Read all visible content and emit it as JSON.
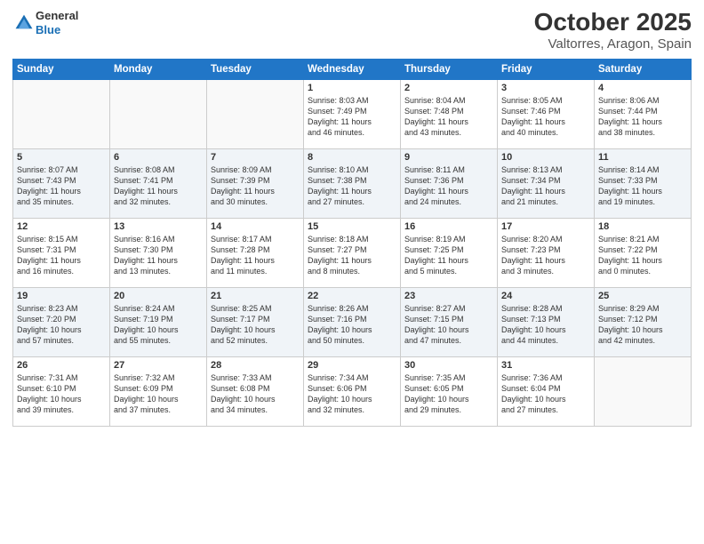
{
  "header": {
    "logo_line1": "General",
    "logo_line2": "Blue",
    "title": "October 2025",
    "subtitle": "Valtorres, Aragon, Spain"
  },
  "days_of_week": [
    "Sunday",
    "Monday",
    "Tuesday",
    "Wednesday",
    "Thursday",
    "Friday",
    "Saturday"
  ],
  "weeks": [
    [
      {
        "num": "",
        "info": ""
      },
      {
        "num": "",
        "info": ""
      },
      {
        "num": "",
        "info": ""
      },
      {
        "num": "1",
        "info": "Sunrise: 8:03 AM\nSunset: 7:49 PM\nDaylight: 11 hours\nand 46 minutes."
      },
      {
        "num": "2",
        "info": "Sunrise: 8:04 AM\nSunset: 7:48 PM\nDaylight: 11 hours\nand 43 minutes."
      },
      {
        "num": "3",
        "info": "Sunrise: 8:05 AM\nSunset: 7:46 PM\nDaylight: 11 hours\nand 40 minutes."
      },
      {
        "num": "4",
        "info": "Sunrise: 8:06 AM\nSunset: 7:44 PM\nDaylight: 11 hours\nand 38 minutes."
      }
    ],
    [
      {
        "num": "5",
        "info": "Sunrise: 8:07 AM\nSunset: 7:43 PM\nDaylight: 11 hours\nand 35 minutes."
      },
      {
        "num": "6",
        "info": "Sunrise: 8:08 AM\nSunset: 7:41 PM\nDaylight: 11 hours\nand 32 minutes."
      },
      {
        "num": "7",
        "info": "Sunrise: 8:09 AM\nSunset: 7:39 PM\nDaylight: 11 hours\nand 30 minutes."
      },
      {
        "num": "8",
        "info": "Sunrise: 8:10 AM\nSunset: 7:38 PM\nDaylight: 11 hours\nand 27 minutes."
      },
      {
        "num": "9",
        "info": "Sunrise: 8:11 AM\nSunset: 7:36 PM\nDaylight: 11 hours\nand 24 minutes."
      },
      {
        "num": "10",
        "info": "Sunrise: 8:13 AM\nSunset: 7:34 PM\nDaylight: 11 hours\nand 21 minutes."
      },
      {
        "num": "11",
        "info": "Sunrise: 8:14 AM\nSunset: 7:33 PM\nDaylight: 11 hours\nand 19 minutes."
      }
    ],
    [
      {
        "num": "12",
        "info": "Sunrise: 8:15 AM\nSunset: 7:31 PM\nDaylight: 11 hours\nand 16 minutes."
      },
      {
        "num": "13",
        "info": "Sunrise: 8:16 AM\nSunset: 7:30 PM\nDaylight: 11 hours\nand 13 minutes."
      },
      {
        "num": "14",
        "info": "Sunrise: 8:17 AM\nSunset: 7:28 PM\nDaylight: 11 hours\nand 11 minutes."
      },
      {
        "num": "15",
        "info": "Sunrise: 8:18 AM\nSunset: 7:27 PM\nDaylight: 11 hours\nand 8 minutes."
      },
      {
        "num": "16",
        "info": "Sunrise: 8:19 AM\nSunset: 7:25 PM\nDaylight: 11 hours\nand 5 minutes."
      },
      {
        "num": "17",
        "info": "Sunrise: 8:20 AM\nSunset: 7:23 PM\nDaylight: 11 hours\nand 3 minutes."
      },
      {
        "num": "18",
        "info": "Sunrise: 8:21 AM\nSunset: 7:22 PM\nDaylight: 11 hours\nand 0 minutes."
      }
    ],
    [
      {
        "num": "19",
        "info": "Sunrise: 8:23 AM\nSunset: 7:20 PM\nDaylight: 10 hours\nand 57 minutes."
      },
      {
        "num": "20",
        "info": "Sunrise: 8:24 AM\nSunset: 7:19 PM\nDaylight: 10 hours\nand 55 minutes."
      },
      {
        "num": "21",
        "info": "Sunrise: 8:25 AM\nSunset: 7:17 PM\nDaylight: 10 hours\nand 52 minutes."
      },
      {
        "num": "22",
        "info": "Sunrise: 8:26 AM\nSunset: 7:16 PM\nDaylight: 10 hours\nand 50 minutes."
      },
      {
        "num": "23",
        "info": "Sunrise: 8:27 AM\nSunset: 7:15 PM\nDaylight: 10 hours\nand 47 minutes."
      },
      {
        "num": "24",
        "info": "Sunrise: 8:28 AM\nSunset: 7:13 PM\nDaylight: 10 hours\nand 44 minutes."
      },
      {
        "num": "25",
        "info": "Sunrise: 8:29 AM\nSunset: 7:12 PM\nDaylight: 10 hours\nand 42 minutes."
      }
    ],
    [
      {
        "num": "26",
        "info": "Sunrise: 7:31 AM\nSunset: 6:10 PM\nDaylight: 10 hours\nand 39 minutes."
      },
      {
        "num": "27",
        "info": "Sunrise: 7:32 AM\nSunset: 6:09 PM\nDaylight: 10 hours\nand 37 minutes."
      },
      {
        "num": "28",
        "info": "Sunrise: 7:33 AM\nSunset: 6:08 PM\nDaylight: 10 hours\nand 34 minutes."
      },
      {
        "num": "29",
        "info": "Sunrise: 7:34 AM\nSunset: 6:06 PM\nDaylight: 10 hours\nand 32 minutes."
      },
      {
        "num": "30",
        "info": "Sunrise: 7:35 AM\nSunset: 6:05 PM\nDaylight: 10 hours\nand 29 minutes."
      },
      {
        "num": "31",
        "info": "Sunrise: 7:36 AM\nSunset: 6:04 PM\nDaylight: 10 hours\nand 27 minutes."
      },
      {
        "num": "",
        "info": ""
      }
    ]
  ]
}
